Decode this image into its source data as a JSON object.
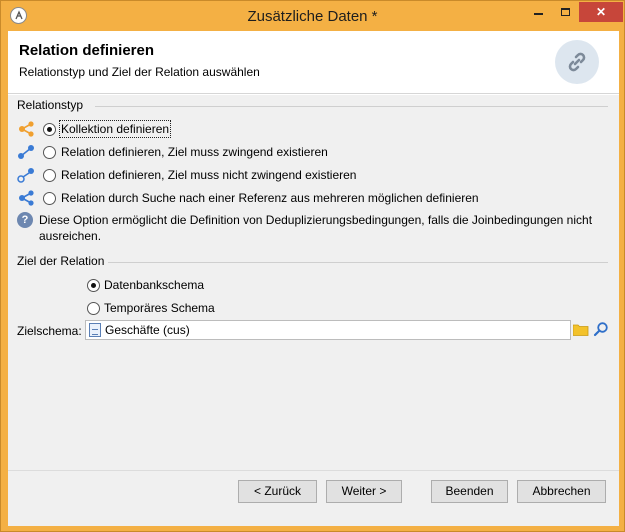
{
  "window": {
    "title": "Zusätzliche Daten *",
    "close_glyph": "✕"
  },
  "header": {
    "title": "Relation definieren",
    "subtitle": "Relationstyp und Ziel der Relation auswählen",
    "icon": "link-icon"
  },
  "relationstyp": {
    "label": "Relationstyp",
    "options": [
      {
        "label": "Kollektion definieren",
        "checked": true,
        "icon": "collection-link-icon",
        "icon_color": "#f0a030"
      },
      {
        "label": "Relation definieren, Ziel muss zwingend existieren",
        "checked": false,
        "icon": "link-required-icon",
        "icon_color": "#3a7bd5"
      },
      {
        "label": "Relation definieren, Ziel muss nicht zwingend existieren",
        "checked": false,
        "icon": "link-optional-icon",
        "icon_color": "#3a7bd5"
      },
      {
        "label": "Relation durch Suche nach einer Referenz aus mehreren möglichen definieren",
        "checked": false,
        "icon": "link-search-icon",
        "icon_color": "#3a7bd5"
      }
    ],
    "info_line1": "Diese Option ermöglicht die Definition von Deduplizierungsbedingungen, falls die Joinbedingungen nicht",
    "info_line2": "ausreichen."
  },
  "ziel": {
    "label": "Ziel der Relation",
    "options": [
      {
        "label": "Datenbankschema",
        "checked": true
      },
      {
        "label": "Temporäres Schema",
        "checked": false
      }
    ],
    "zielschema_label": "Zielschema:",
    "zielschema_value": "Geschäfte (cus)"
  },
  "footer": {
    "back": "< Zurück",
    "next": "Weiter >",
    "finish": "Beenden",
    "cancel": "Abbrechen"
  },
  "colors": {
    "title_bar": "#f4b044",
    "close_button": "#c7463a",
    "accent_orange": "#f0a030",
    "accent_blue": "#3a7bd5"
  }
}
